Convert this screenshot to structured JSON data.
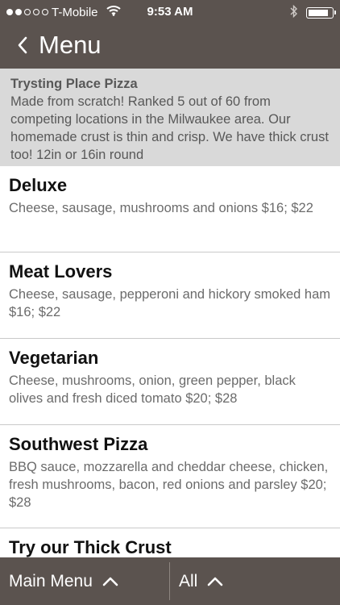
{
  "status_bar": {
    "carrier": "T-Mobile",
    "time": "9:53 AM",
    "signal_icon": "signal-dots-icon",
    "wifi_icon": "wifi-icon",
    "bluetooth_icon": "bluetooth-icon",
    "battery_icon": "battery-icon",
    "battery_level": 0.9
  },
  "nav": {
    "back_icon": "chevron-left-icon",
    "title": "Menu"
  },
  "intro": {
    "name": "Trysting Place Pizza",
    "text": "Made from scratch! Ranked 5 out of 60 from competing locations in the Milwaukee area. Our homemade crust is thin and crisp. We have thick crust too!  12in or 16in round"
  },
  "items": [
    {
      "title": "Deluxe",
      "desc": "Cheese, sausage, mushrooms and onions $16; $22"
    },
    {
      "title": "Meat Lovers",
      "desc": "Cheese, sausage, pepperoni and hickory smoked ham $16; $22"
    },
    {
      "title": "Vegetarian",
      "desc": "Cheese, mushrooms, onion, green pepper, black olives and fresh diced tomato $20; $28"
    },
    {
      "title": "Southwest Pizza",
      "desc": "BBQ sauce, mozzarella and cheddar cheese, chicken, fresh mushrooms, bacon, red onions and parsley $20; $28"
    },
    {
      "title": "Try our Thick Crust",
      "desc": ""
    }
  ],
  "bottom_bar": {
    "main_menu_label": "Main Menu",
    "all_label": "All",
    "chevron_icon": "chevron-up-icon"
  },
  "colors": {
    "header": "#5b534f",
    "intro_bg": "#d9d9d9",
    "divider": "#c9c9c9"
  }
}
